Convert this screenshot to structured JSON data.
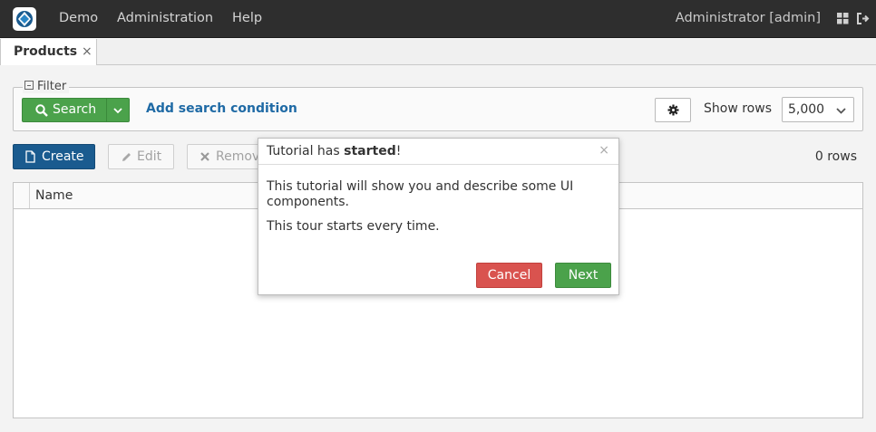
{
  "topbar": {
    "menu": [
      "Demo",
      "Administration",
      "Help"
    ],
    "user": "Administrator [admin]",
    "icons": [
      "app-logo-icon",
      "grid-icon",
      "logout-icon"
    ]
  },
  "tabs": [
    {
      "label": "Products",
      "close": "×"
    }
  ],
  "filter": {
    "legend": "Filter",
    "search_label": "Search",
    "add_condition": "Add search condition",
    "show_rows_label": "Show rows",
    "show_rows_value": "5,000"
  },
  "actions": {
    "create": "Create",
    "edit": "Edit",
    "remove": "Remove",
    "rows_count": "0 rows"
  },
  "table": {
    "columns": [
      "Name"
    ]
  },
  "dialog": {
    "title_prefix": "Tutorial has ",
    "title_bold": "started",
    "title_suffix": "!",
    "close": "×",
    "body_line1": "This tutorial will show you and describe some UI components.",
    "body_line2": "This tour starts every time.",
    "cancel": "Cancel",
    "next": "Next"
  },
  "colors": {
    "topbar_bg": "#2e2e2e",
    "primary": "#1a5b8f",
    "success": "#4ba24b",
    "danger": "#d9534f",
    "link": "#1f6aa5"
  }
}
